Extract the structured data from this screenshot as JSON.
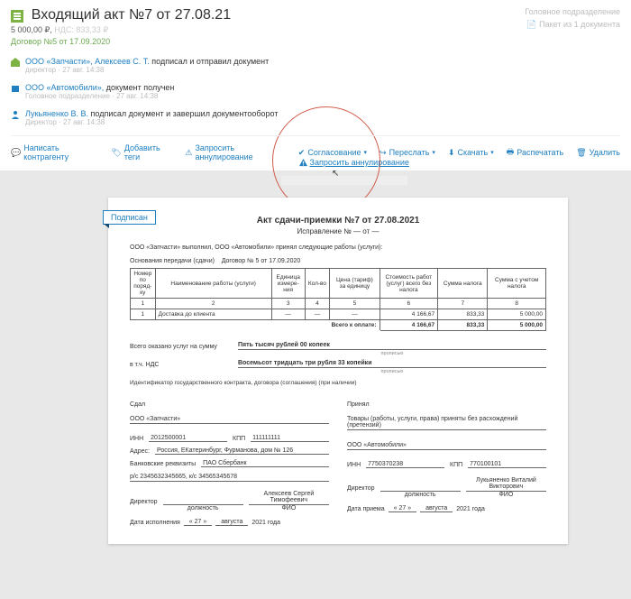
{
  "header": {
    "title": "Входящий акт №7 от 27.08.21",
    "price": "5 000,00 ₽,",
    "nds": "НДС: 833,33 ₽",
    "contract": "Договор №5 от 17.09.2020",
    "division": "Головное подразделение",
    "package": "Пакет из 1 документа"
  },
  "timeline": [
    {
      "who": "ООО «Запчасти», Алексеев С. Т.",
      "rest": "подписал и отправил документ",
      "meta": "директор · 27 авг. 14:38",
      "color": "#7cb342"
    },
    {
      "who": "ООО «Автомобили»,",
      "rest": "документ получен",
      "meta": "Головное подразделение · 27 авг. 14:38",
      "color": "#1e7fc1"
    },
    {
      "who": "Лукьяненко В. В.",
      "rest": "подписал документ и завершил документооборот",
      "meta": "Директор · 27 авг. 14:38",
      "color": "#1e7fc1"
    }
  ],
  "callout": {
    "label": "Запросить аннулирование"
  },
  "actions": {
    "write": "Написать контрагенту",
    "tags": "Добавить теги",
    "annul": "Запросить аннулирование",
    "approve": "Согласование",
    "forward": "Переслать",
    "download": "Скачать",
    "print": "Распечатать",
    "delete": "Удалить"
  },
  "doc": {
    "badge": "Подписан",
    "title": "Акт сдачи-приемки №7 от 27.08.2021",
    "correction": "Исправление № — от —",
    "intro": "ООО «Запчасти» выполнил, ООО «Автомобили» принял следующие работы (услуги):",
    "basis_label": "Основания передачи (сдачи)",
    "basis_value": "Договор № 5 от 17.09.2020",
    "table": {
      "headers": [
        "Номер по поряд-ку",
        "Наименование работы (услуги)",
        "Единица измере-ния",
        "Кол-во",
        "Цена (тариф) за единицу",
        "Стоимость работ (услуг) всего без налога",
        "Сумма налога",
        "Сумма с учетом налога"
      ],
      "nums": [
        "1",
        "2",
        "3",
        "4",
        "5",
        "6",
        "7",
        "8"
      ],
      "row": [
        "1",
        "Доставка до клиента",
        "—",
        "—",
        "—",
        "4 166,67",
        "833,33",
        "5 000,00"
      ],
      "total_label": "Всего к оплате:",
      "totals": [
        "4 166,67",
        "833,33",
        "5 000,00"
      ]
    },
    "summary": {
      "l1_label": "Всего оказано услуг на сумму",
      "l1_value": "Пять тысяч рублей 00 копеек",
      "l2_label": "в т.ч. НДС",
      "l2_value": "Восемьсот тридцать три рубля 33 копейки",
      "hint": "прописью"
    },
    "id_contract": "Идентификатор государственного контракта, договора (соглашения) (при наличии)",
    "left": {
      "title": "Сдал",
      "org": "ООО «Запчасти»",
      "inn_l": "ИНН",
      "inn_v": "2012500001",
      "kpp_l": "КПП",
      "kpp_v": "111111111",
      "addr_l": "Адрес:",
      "addr_v": "Россия, ЕКатеринбург, Фурманова, дом № 126",
      "bank_l": "Банковские реквизиты",
      "bank_v": "ПАО Сбербанк",
      "rs": "р/с 2345632345665, к/с 34565345678",
      "sig_l": "Директор",
      "sig_name": "Алексеев Сергей Тимофеевич",
      "sig_hint_l": "должность",
      "sig_hint_r": "ФИО",
      "date_l": "Дата исполнения",
      "d": "« 27 »",
      "m": "августа",
      "y": "2021 года"
    },
    "right": {
      "title": "Принял",
      "line1": "Товары (работы, услуги, права) приняты без расхождений (претензий)",
      "org": "ООО «Автомобили»",
      "inn_l": "ИНН",
      "inn_v": "7750370238",
      "kpp_l": "КПП",
      "kpp_v": "770100101",
      "sig_l": "Директор",
      "sig_name": "Лукьяненко Виталий Викторович",
      "sig_hint_l": "должность",
      "sig_hint_r": "ФИО",
      "date_l": "Дата приема",
      "d": "« 27 »",
      "m": "августа",
      "y": "2021 года"
    }
  }
}
